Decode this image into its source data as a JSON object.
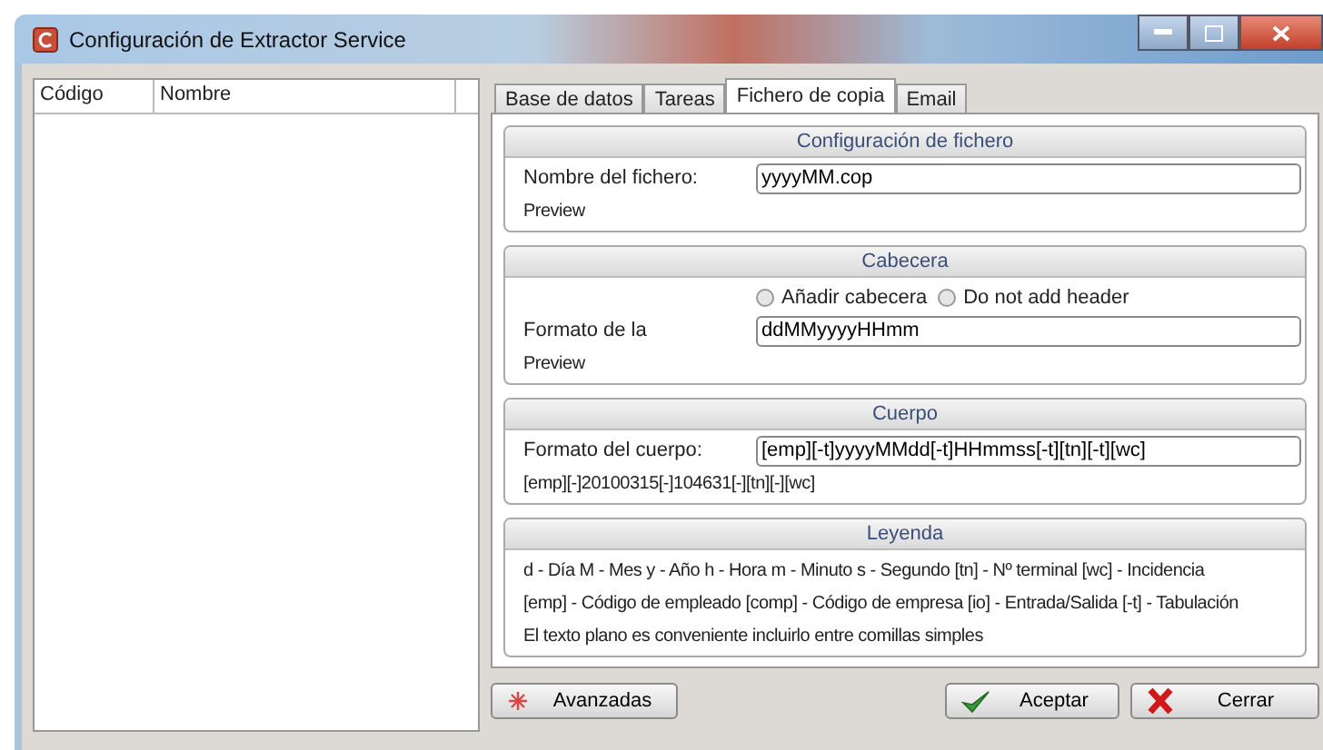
{
  "window": {
    "title": "Configuración de Extractor Service"
  },
  "list": {
    "columns": [
      "Código",
      "Nombre"
    ]
  },
  "tabs": [
    {
      "label": "Base de datos",
      "selected": false
    },
    {
      "label": "Tareas",
      "selected": false
    },
    {
      "label": "Fichero de copia",
      "selected": true
    },
    {
      "label": "Email",
      "selected": false
    }
  ],
  "groups": [
    {
      "title": "Configuración de fichero",
      "rows": [
        {
          "kind": "field",
          "label": "Nombre del fichero:",
          "value": "yyyyMM.cop"
        },
        {
          "kind": "text",
          "text": "Preview"
        }
      ]
    },
    {
      "title": "Cabecera",
      "rows": [
        {
          "kind": "radios",
          "options": [
            {
              "label": "Añadir cabecera",
              "selected": false
            },
            {
              "label": "Do not add header",
              "selected": false
            }
          ]
        },
        {
          "kind": "field",
          "label": "Formato de la",
          "value": "ddMMyyyyHHmm"
        },
        {
          "kind": "text",
          "text": "Preview"
        }
      ]
    },
    {
      "title": "Cuerpo",
      "rows": [
        {
          "kind": "field",
          "label": "Formato del cuerpo:",
          "value": "[emp][-t]yyyyMMdd[-t]HHmmss[-t][tn][-t][wc]"
        },
        {
          "kind": "text",
          "text": "[emp][-]20100315[-]104631[-][tn][-][wc]"
        }
      ]
    },
    {
      "title": "Leyenda",
      "rows": [
        {
          "kind": "text",
          "text": "d - Día   M - Mes  y - Año  h - Hora  m - Minuto  s - Segundo  [tn] - Nº terminal [wc] - Incidencia"
        },
        {
          "kind": "text",
          "text": "[emp] - Código de empleado  [comp] - Código de empresa [io] - Entrada/Salida [-t] - Tabulación"
        },
        {
          "kind": "text",
          "text": "El texto plano es conveniente incluirlo entre comillas simples"
        }
      ]
    }
  ],
  "buttons": [
    {
      "kind": "advanced",
      "label": "Avanzadas"
    },
    {
      "kind": "accept",
      "label": "Aceptar"
    },
    {
      "kind": "close",
      "label": "Cerrar"
    }
  ]
}
